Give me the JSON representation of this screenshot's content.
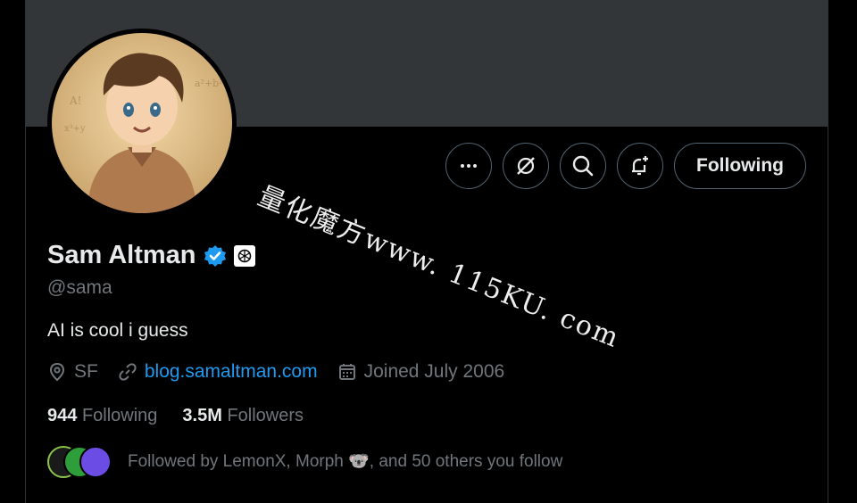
{
  "profile": {
    "name": "Sam Altman",
    "handle": "@sama",
    "bio": "AI is cool i guess",
    "location": "SF",
    "website": "blog.samaltman.com",
    "joined": "Joined July 2006",
    "following_count": "944",
    "following_label": "Following",
    "followers_count": "3.5M",
    "followers_label": "Followers",
    "followed_by": "Followed by LemonX, Morph 🐨, and 50 others you follow"
  },
  "actions": {
    "more_icon": "more-icon",
    "grok_icon": "grok-icon",
    "search_icon": "search-icon",
    "notify_icon": "bell-plus-icon",
    "follow_button": "Following"
  },
  "watermark": "量化魔方www. 115KU. com",
  "colors": {
    "background": "#000000",
    "banner": "#333639",
    "verified": "#1d9bf0",
    "link": "#1d9bf0",
    "muted": "#71767b",
    "text": "#e7e9ea"
  }
}
